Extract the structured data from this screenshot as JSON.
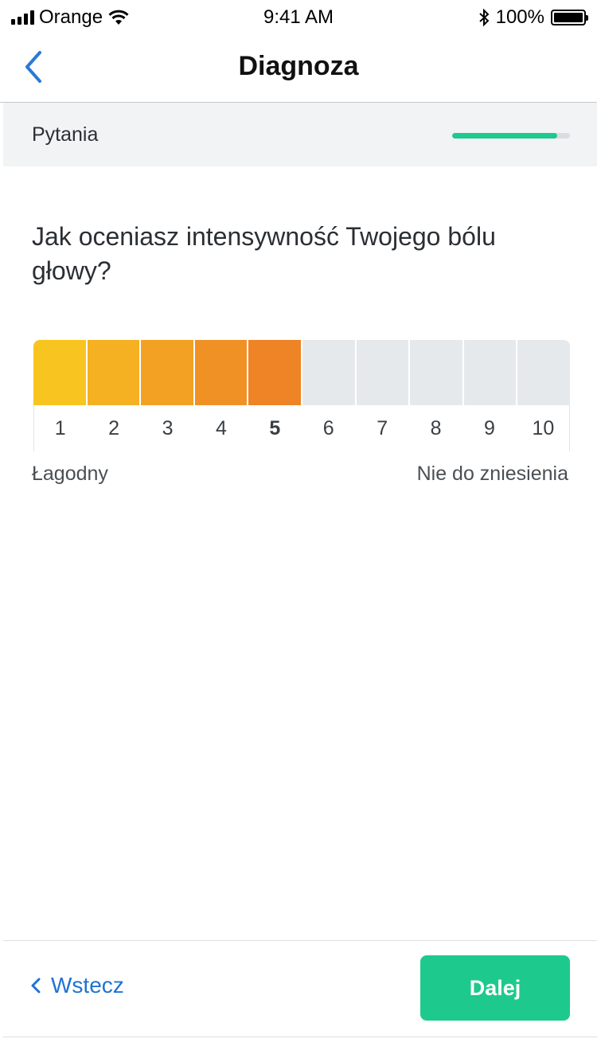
{
  "status_bar": {
    "carrier": "Orange",
    "time": "9:41 AM",
    "battery": "100%"
  },
  "nav": {
    "title": "Diagnoza",
    "back_icon": "chevron-left-icon"
  },
  "progress": {
    "label": "Pytania",
    "fraction": 0.89,
    "color": "#1ec98e"
  },
  "question": {
    "text": "Jak oceniasz intensywność Twojego bólu głowy?"
  },
  "scale": {
    "values": [
      "1",
      "2",
      "3",
      "4",
      "5",
      "6",
      "7",
      "8",
      "9",
      "10"
    ],
    "selected": 5,
    "filled_colors": [
      "#f8c41f",
      "#f5b122",
      "#f2a123",
      "#f09125",
      "#ee8426"
    ],
    "empty_color": "#e6e9eb",
    "min_label": "Łagodny",
    "max_label": "Nie do zniesienia"
  },
  "footer": {
    "back_label": "Wstecz",
    "back_icon": "chevron-left-icon",
    "next_label": "Dalej",
    "accent": "#1ec98e",
    "link_color": "#1f73d0"
  }
}
